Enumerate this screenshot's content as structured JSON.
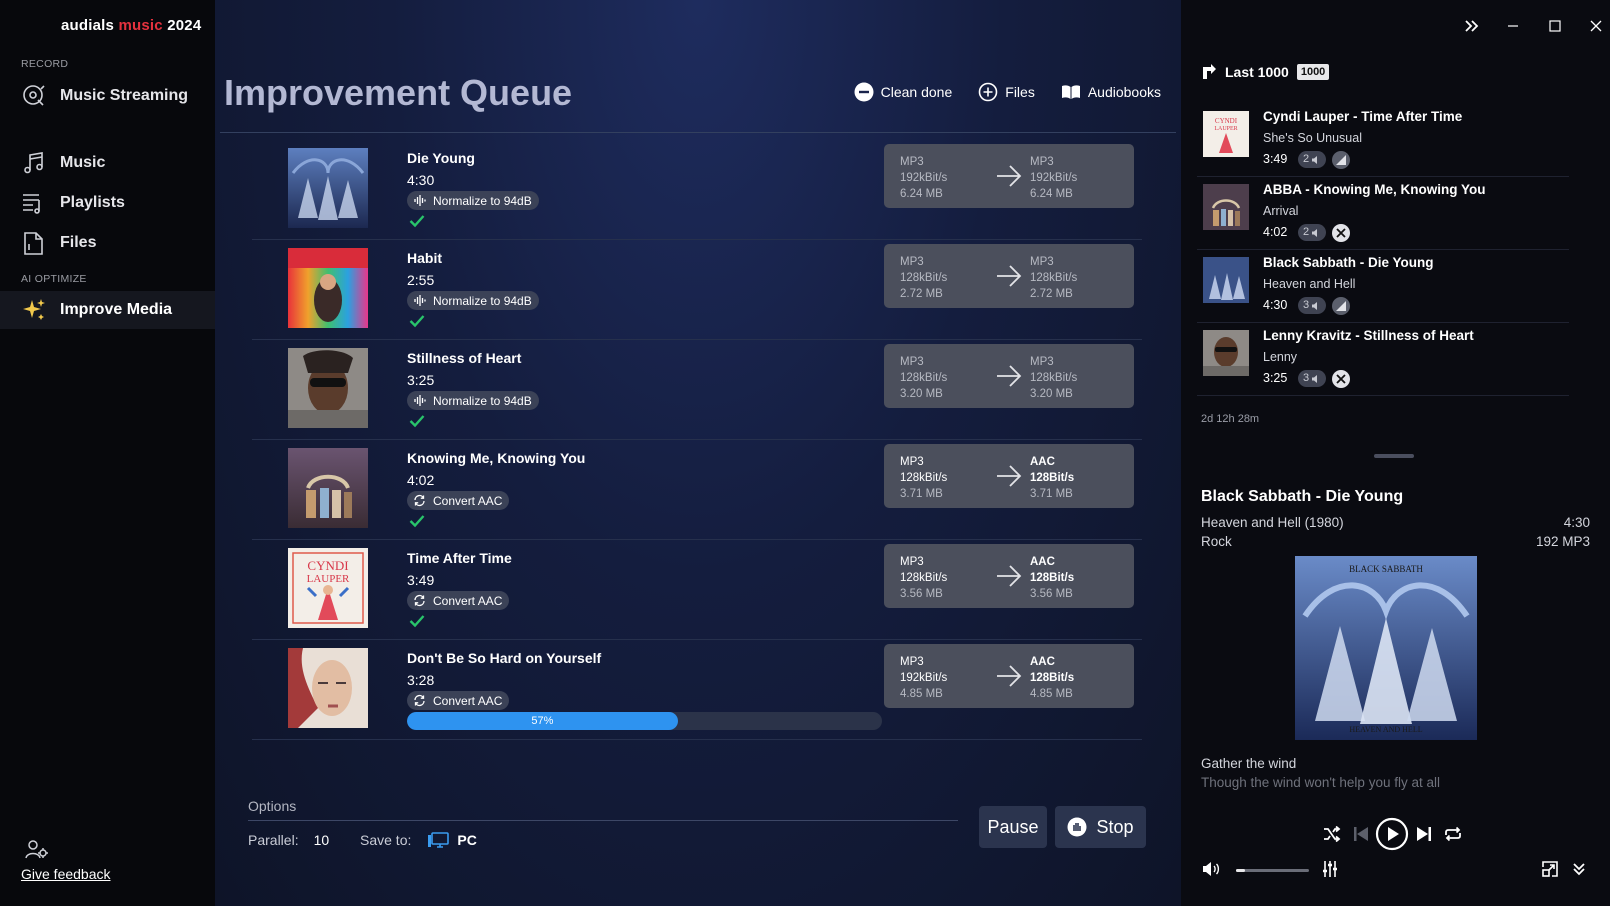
{
  "app": {
    "brand_part1": "audials",
    "brand_part2": "music",
    "brand_part3": "2024"
  },
  "sidebar": {
    "section_record": "RECORD",
    "section_ai": "AI OPTIMIZE",
    "items": [
      {
        "label": "Music Streaming",
        "icon": "music-streaming-icon"
      },
      {
        "label": "Music",
        "icon": "music-note-icon"
      },
      {
        "label": "Playlists",
        "icon": "playlist-icon"
      },
      {
        "label": "Files",
        "icon": "file-icon"
      },
      {
        "label": "Improve Media",
        "icon": "sparkle-icon",
        "active": true
      }
    ],
    "feedback_label": "Give feedback"
  },
  "main": {
    "title": "Improvement Queue",
    "actions": {
      "clean_done": "Clean done",
      "files": "Files",
      "audiobooks": "Audiobooks"
    },
    "queue": [
      {
        "title": "Die Young",
        "duration": "4:30",
        "action": "Normalize to 94dB",
        "action_icon": "waveform-icon",
        "done": true,
        "src": [
          "MP3",
          "192kBit/s",
          "6.24 MB"
        ],
        "dst": [
          "MP3",
          "192kBit/s",
          "6.24 MB"
        ],
        "dst_changed": false
      },
      {
        "title": "Habit",
        "duration": "2:55",
        "action": "Normalize to 94dB",
        "action_icon": "waveform-icon",
        "done": true,
        "src": [
          "MP3",
          "128kBit/s",
          "2.72 MB"
        ],
        "dst": [
          "MP3",
          "128kBit/s",
          "2.72 MB"
        ],
        "dst_changed": false
      },
      {
        "title": "Stillness of Heart",
        "duration": "3:25",
        "action": "Normalize to 94dB",
        "action_icon": "waveform-icon",
        "done": true,
        "src": [
          "MP3",
          "128kBit/s",
          "3.20 MB"
        ],
        "dst": [
          "MP3",
          "128kBit/s",
          "3.20 MB"
        ],
        "dst_changed": false
      },
      {
        "title": "Knowing Me, Knowing You",
        "duration": "4:02",
        "action": "Convert AAC",
        "action_icon": "convert-icon",
        "done": true,
        "src": [
          "MP3",
          "128kBit/s",
          "3.71 MB"
        ],
        "dst": [
          "AAC",
          "128Bit/s",
          "3.71 MB"
        ],
        "dst_changed": true
      },
      {
        "title": "Time After Time",
        "duration": "3:49",
        "action": "Convert AAC",
        "action_icon": "convert-icon",
        "done": true,
        "src": [
          "MP3",
          "128kBit/s",
          "3.56 MB"
        ],
        "dst": [
          "AAC",
          "128Bit/s",
          "3.56 MB"
        ],
        "dst_changed": true
      },
      {
        "title": "Don't Be So Hard on Yourself",
        "duration": "3:28",
        "action": "Convert AAC",
        "action_icon": "convert-icon",
        "done": false,
        "progress": 0.57,
        "progress_label": "57%",
        "src": [
          "MP3",
          "192kBit/s",
          "4.85 MB"
        ],
        "dst": [
          "AAC",
          "128Bit/s",
          "4.85 MB"
        ],
        "dst_changed": true
      }
    ],
    "options": {
      "label": "Options",
      "parallel_label": "Parallel:",
      "parallel_value": "10",
      "save_to_label": "Save to:",
      "save_to_value": "PC"
    },
    "pause_label": "Pause",
    "stop_label": "Stop"
  },
  "right": {
    "last_label": "Last 1000",
    "last_count": "1000",
    "history": [
      {
        "title": "Cyndi Lauper - Time After Time",
        "album": "She's So Unusual",
        "duration": "3:49",
        "count": "2",
        "state": "dim"
      },
      {
        "title": "ABBA - Knowing Me, Knowing You",
        "album": "Arrival",
        "duration": "4:02",
        "count": "2",
        "state": "cut"
      },
      {
        "title": "Black Sabbath - Die Young",
        "album": "Heaven and Hell",
        "duration": "4:30",
        "count": "3",
        "state": "dim"
      },
      {
        "title": "Lenny Kravitz - Stillness of Heart",
        "album": "Lenny",
        "duration": "3:25",
        "count": "3",
        "state": "cut"
      }
    ],
    "time_ago": "2d 12h 28m",
    "now_playing": {
      "title": "Black Sabbath - Die Young",
      "album": "Heaven and Hell (1980)",
      "genre": "Rock",
      "duration": "4:30",
      "format": "192 MP3",
      "cover_text_top": "BLACK SABBATH",
      "cover_text_bottom": "HEAVEN AND HELL",
      "lyric_current": "Gather the wind",
      "lyric_next": "Though the wind won't help you fly at all"
    },
    "volume": 0.12
  },
  "colors": {
    "accent_blue": "#2e93f0",
    "brand_red": "#e5323e",
    "check_green": "#29c46b"
  }
}
